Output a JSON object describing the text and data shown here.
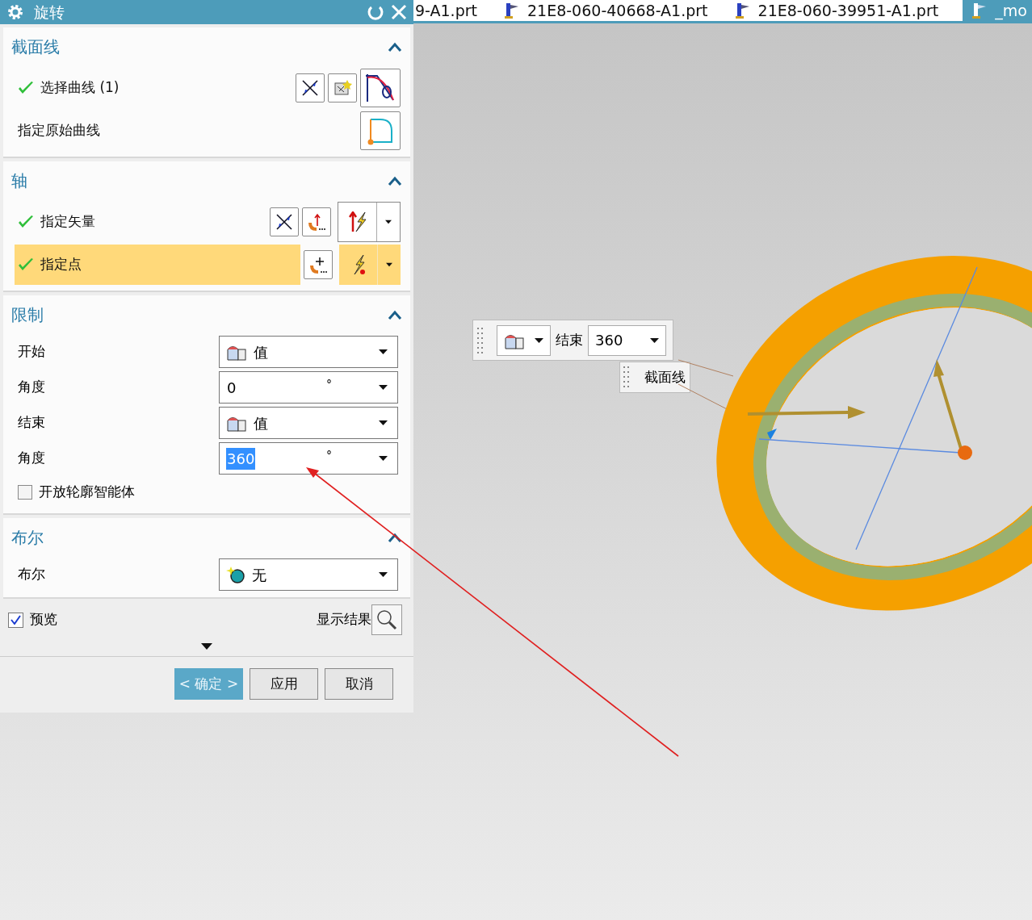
{
  "dialog": {
    "title": "旋转",
    "sections": [
      {
        "title": "截面线",
        "expanded": true,
        "rows": [
          {
            "kind": "curve_select",
            "label": "选择曲线 (1)",
            "done": true,
            "highlighted": false
          },
          {
            "kind": "origin_curve",
            "label": "指定原始曲线",
            "done": false,
            "highlighted": false
          }
        ]
      },
      {
        "title": "轴",
        "expanded": true,
        "rows": [
          {
            "kind": "vector",
            "label": "指定矢量",
            "done": true,
            "highlighted": false
          },
          {
            "kind": "point",
            "label": "指定点",
            "done": true,
            "highlighted": true
          }
        ]
      },
      {
        "title": "限制",
        "expanded": true,
        "rows": [
          {
            "kind": "dropdown",
            "label": "开始",
            "value": "值"
          },
          {
            "kind": "number",
            "label": "角度",
            "value": "0",
            "unit": "°",
            "selected": false
          },
          {
            "kind": "dropdown",
            "label": "结束",
            "value": "值"
          },
          {
            "kind": "number",
            "label": "角度",
            "value": "360",
            "unit": "°",
            "selected": true
          },
          {
            "kind": "checkbox",
            "label": "开放轮廓智能体",
            "checked": false
          }
        ]
      },
      {
        "title": "布尔",
        "expanded": true,
        "rows": [
          {
            "kind": "bool_dropdown",
            "label": "布尔",
            "value": "无"
          }
        ]
      }
    ],
    "preview": {
      "label": "预览",
      "checked": true
    },
    "show_result": "显示结果",
    "buttons": [
      {
        "label": "< 确定 >",
        "primary": true
      },
      {
        "label": "应用",
        "primary": false
      },
      {
        "label": "取消",
        "primary": false
      }
    ]
  },
  "tabs": [
    {
      "label": "9-A1.prt",
      "selected": false,
      "icon": false
    },
    {
      "label": "21E8-060-40668-A1.prt",
      "selected": false,
      "icon": true
    },
    {
      "label": "21E8-060-39951-A1.prt",
      "selected": false,
      "icon": true
    },
    {
      "label": "_mo",
      "selected": true,
      "icon": true
    }
  ],
  "viewport": {
    "end_toolbar": {
      "label": "结束",
      "value": "360"
    },
    "section_label": "截面线"
  }
}
